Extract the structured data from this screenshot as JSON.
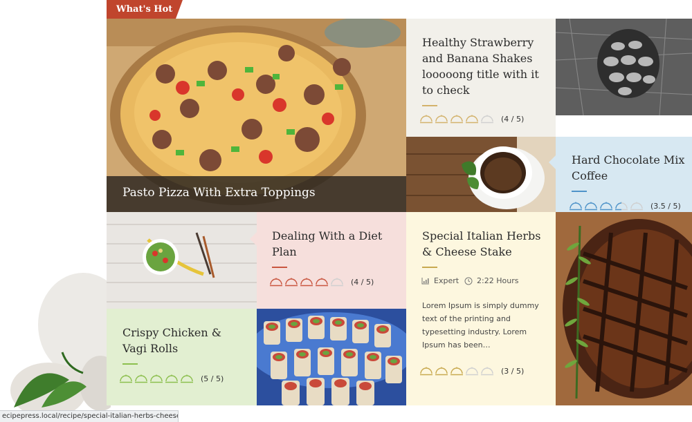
{
  "section_label": "What's Hot",
  "tiles": {
    "pizza": {
      "title": "Pasto Pizza With Extra Toppings"
    },
    "shakes": {
      "title": "Healthy Strawberry and Banana Shakes looooong title with it to check",
      "score": "(4 / 5)",
      "rating": 4,
      "color": "#d3b26b"
    },
    "chocolate": {
      "title": "Hard Chocolate Mix Coffee",
      "score": "(3.5 / 5)",
      "rating": 3.5,
      "color": "#4e93c9"
    },
    "diet": {
      "title": "Dealing With a Diet Plan",
      "score": "(4 / 5)",
      "rating": 4,
      "color": "#c9553f"
    },
    "herbs": {
      "title": "Special Italian Herbs & Cheese Stake",
      "difficulty": "Expert",
      "time": "2:22 Hours",
      "excerpt": "Lorem Ipsum is simply dummy text of the printing and typesetting industry. Lorem Ipsum has been…",
      "score": "(3 / 5)",
      "rating": 3,
      "color": "#c8a94f"
    },
    "chicken": {
      "title": "Crispy Chicken & Vagi Rolls",
      "score": "(5 / 5)",
      "rating": 5,
      "color": "#8cbf4e"
    }
  },
  "status_url": "ecipepress.local/recipe/special-italian-herbs-cheese-stake/"
}
